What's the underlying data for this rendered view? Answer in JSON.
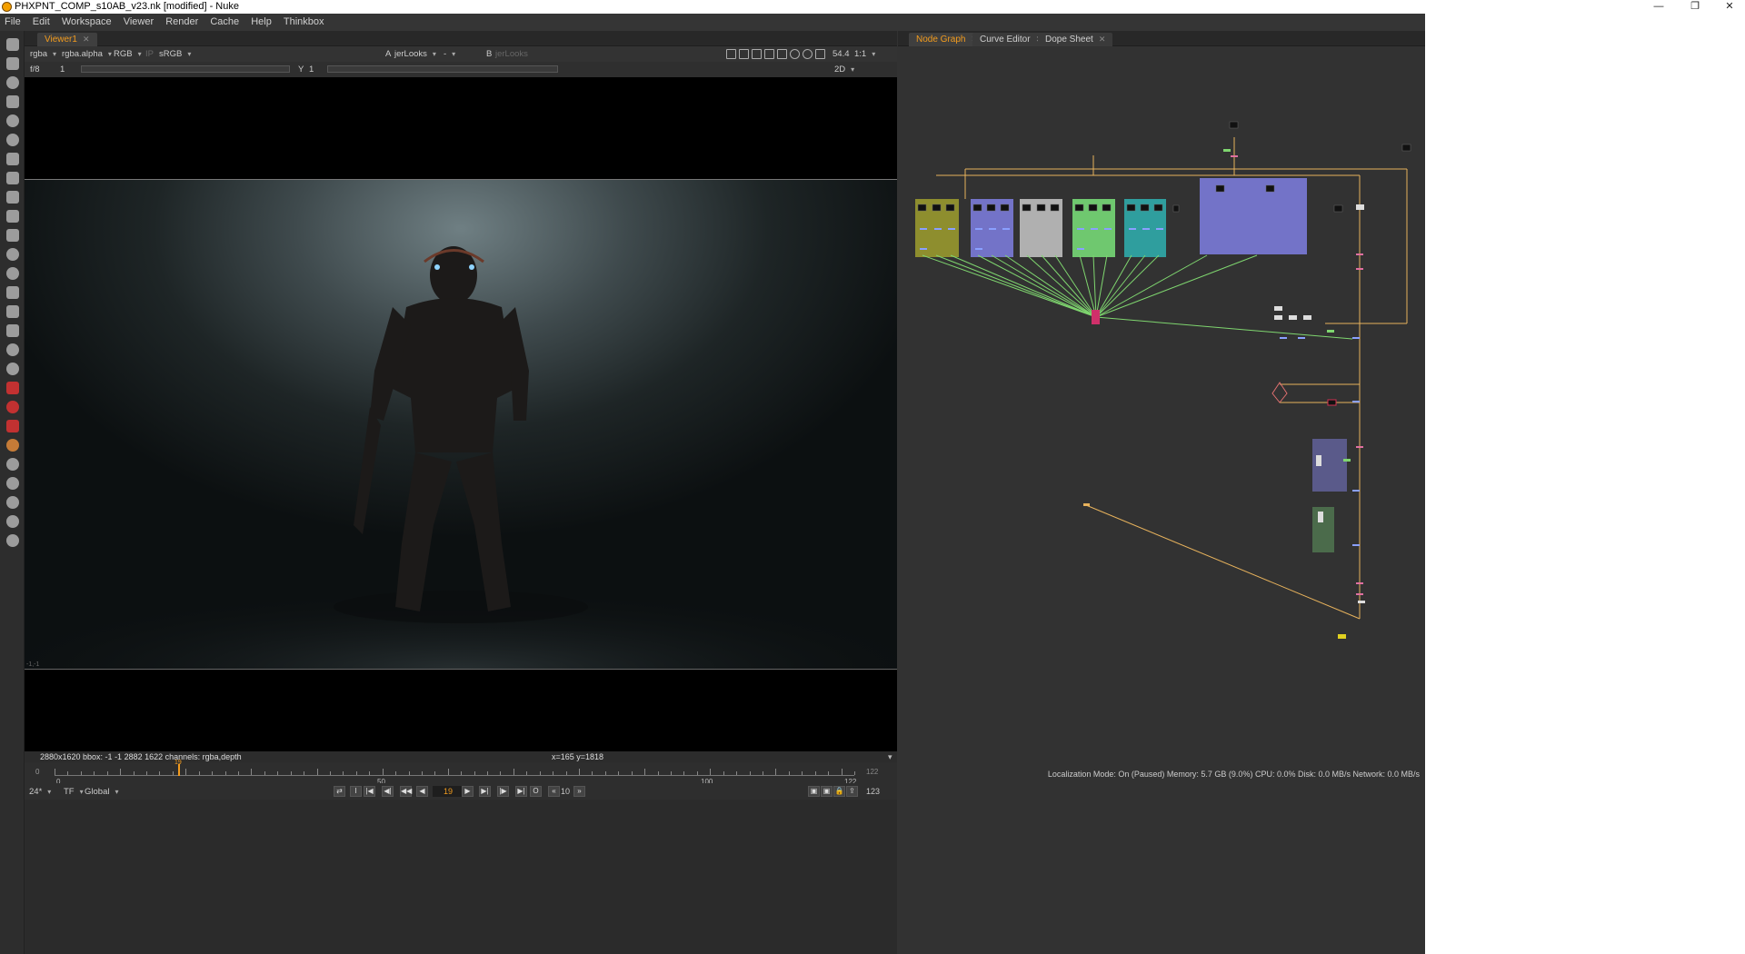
{
  "window": {
    "title": "PHXPNT_COMP_s10AB_v23.nk [modified] - Nuke"
  },
  "menu": [
    "File",
    "Edit",
    "Workspace",
    "Viewer",
    "Render",
    "Cache",
    "Help",
    "Thinkbox"
  ],
  "viewer": {
    "tab_label": "Viewer1",
    "channels": "rgba",
    "alpha_channel": "rgba.alpha",
    "display_mode": "RGB",
    "ip_label": "IP",
    "colorspace": "sRGB",
    "input_a_label": "A",
    "input_a": "jerLooks",
    "merge_op": "-",
    "input_b_label": "B",
    "input_b": "jerLooks",
    "zoom": "54.4",
    "proxy": "1:1",
    "fstop": "f/8",
    "gain": "1",
    "gamma_label": "Y",
    "gamma": "1",
    "view_mode": "2D",
    "info": "2880x1620  bbox: -1 -1 2882 1622 channels: rgba,depth",
    "cursor": "x=165 y=1818",
    "corner_label": "-1,-1"
  },
  "timeline": {
    "start": "0",
    "end": "122",
    "current": "19",
    "marker_label": "19",
    "ticks": [
      "0",
      "50",
      "100",
      "122"
    ],
    "fps": "24*",
    "tf": "TF",
    "scope": "Global",
    "frame": "19",
    "step": "10",
    "end_frame": "123",
    "range_end": "122"
  },
  "graph_tabs": [
    {
      "label": "Node Graph",
      "active": true
    },
    {
      "label": "Curve Editor",
      "active": false
    },
    {
      "label": "Dope Sheet",
      "active": false
    }
  ],
  "status": {
    "text": "Localization Mode: On (Paused) Memory: 5.7 GB (9.0%) CPU: 0.0% Disk: 0.0 MB/s Network: 0.0 MB/s"
  },
  "colors": {
    "accent": "#f39c1e",
    "backdrop_yellow": "#8e8e2e",
    "backdrop_blue": "#7373c8",
    "backdrop_gray": "#b0b0b0",
    "backdrop_green": "#6fc86f",
    "backdrop_teal": "#2f9e9e",
    "wire_green": "#7fd66f",
    "wire_orange": "#e7b25c"
  }
}
